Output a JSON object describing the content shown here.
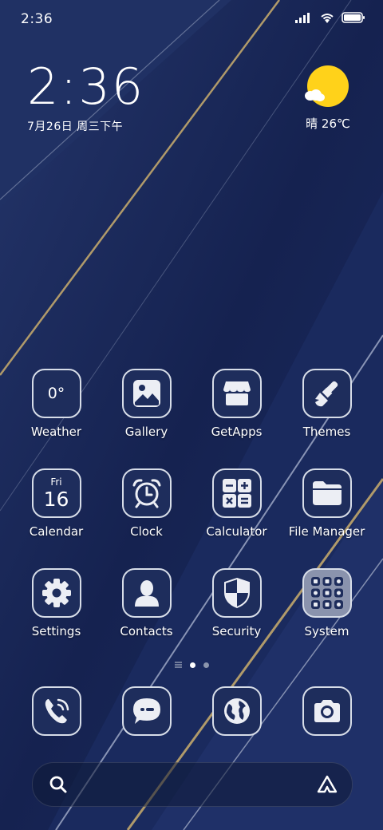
{
  "status_bar": {
    "time": "2:36",
    "battery_level": 0.9
  },
  "clock_widget": {
    "time": "2:36",
    "date": "7月26日 周三下午"
  },
  "weather_widget": {
    "condition_icon": "partly-sunny-icon",
    "text": "晴 26℃"
  },
  "apps": [
    {
      "label": "Weather",
      "icon": "weather-icon",
      "icon_text": "0°"
    },
    {
      "label": "Gallery",
      "icon": "gallery-icon"
    },
    {
      "label": "GetApps",
      "icon": "store-icon"
    },
    {
      "label": "Themes",
      "icon": "brush-icon"
    },
    {
      "label": "Calendar",
      "icon": "calendar-icon",
      "icon_day": "Fri",
      "icon_date": "16"
    },
    {
      "label": "Clock",
      "icon": "alarm-clock-icon"
    },
    {
      "label": "Calculator",
      "icon": "calculator-icon"
    },
    {
      "label": "File Manager",
      "icon": "folder-icon"
    },
    {
      "label": "Settings",
      "icon": "gear-icon"
    },
    {
      "label": "Contacts",
      "icon": "person-icon"
    },
    {
      "label": "Security",
      "icon": "shield-icon"
    },
    {
      "label": "System",
      "icon": "folder-grid-icon"
    }
  ],
  "page_indicator": {
    "pages": 2,
    "current": 1
  },
  "dock": [
    {
      "icon": "phone-icon"
    },
    {
      "icon": "message-icon"
    },
    {
      "icon": "browser-icon"
    },
    {
      "icon": "camera-icon"
    }
  ],
  "search_bar": {
    "left_icon": "search-icon",
    "right_icon": "assistant-icon"
  },
  "colors": {
    "wallpaper": "#1b2a5a",
    "icon_border": "#d7dde8",
    "sun": "#ffd21a",
    "gold_line": "#b09a6a"
  }
}
